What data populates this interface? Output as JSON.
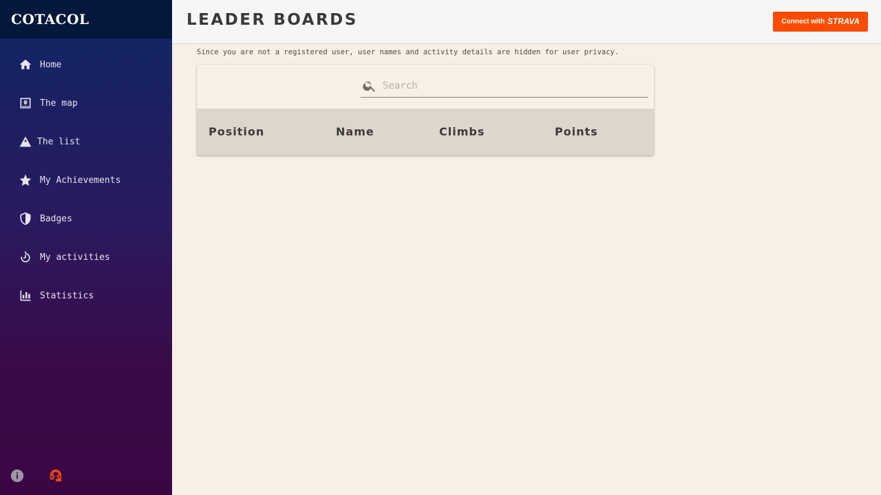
{
  "brand": {
    "logo_text": "COTACOL"
  },
  "header": {
    "title": "LEADER BOARDS",
    "connect_prefix": "Connect with",
    "connect_brand": "STRAVA",
    "connect_color": "#fc4c02"
  },
  "sidebar": {
    "items": [
      {
        "label": "Home",
        "icon": "home-icon"
      },
      {
        "label": "The map",
        "icon": "map-icon"
      },
      {
        "label": "The list",
        "icon": "mountain-icon"
      },
      {
        "label": "My Achievements",
        "icon": "star-icon"
      },
      {
        "label": "Badges",
        "icon": "shield-icon"
      },
      {
        "label": "My activities",
        "icon": "activity-icon"
      },
      {
        "label": "Statistics",
        "icon": "bar-chart-icon"
      }
    ],
    "footer_icons": [
      "info-icon",
      "support-headset-icon"
    ]
  },
  "main": {
    "notice": "Since you are not a registered user, user names and activity details are hidden for user privacy.",
    "search": {
      "placeholder": "Search",
      "value": ""
    },
    "table": {
      "columns": [
        "Position",
        "Name",
        "Climbs",
        "Points"
      ],
      "rows": []
    }
  },
  "colors": {
    "background": "#f8f0e5",
    "header_row": "#ddd6cc",
    "strava_orange": "#fc4c02"
  }
}
